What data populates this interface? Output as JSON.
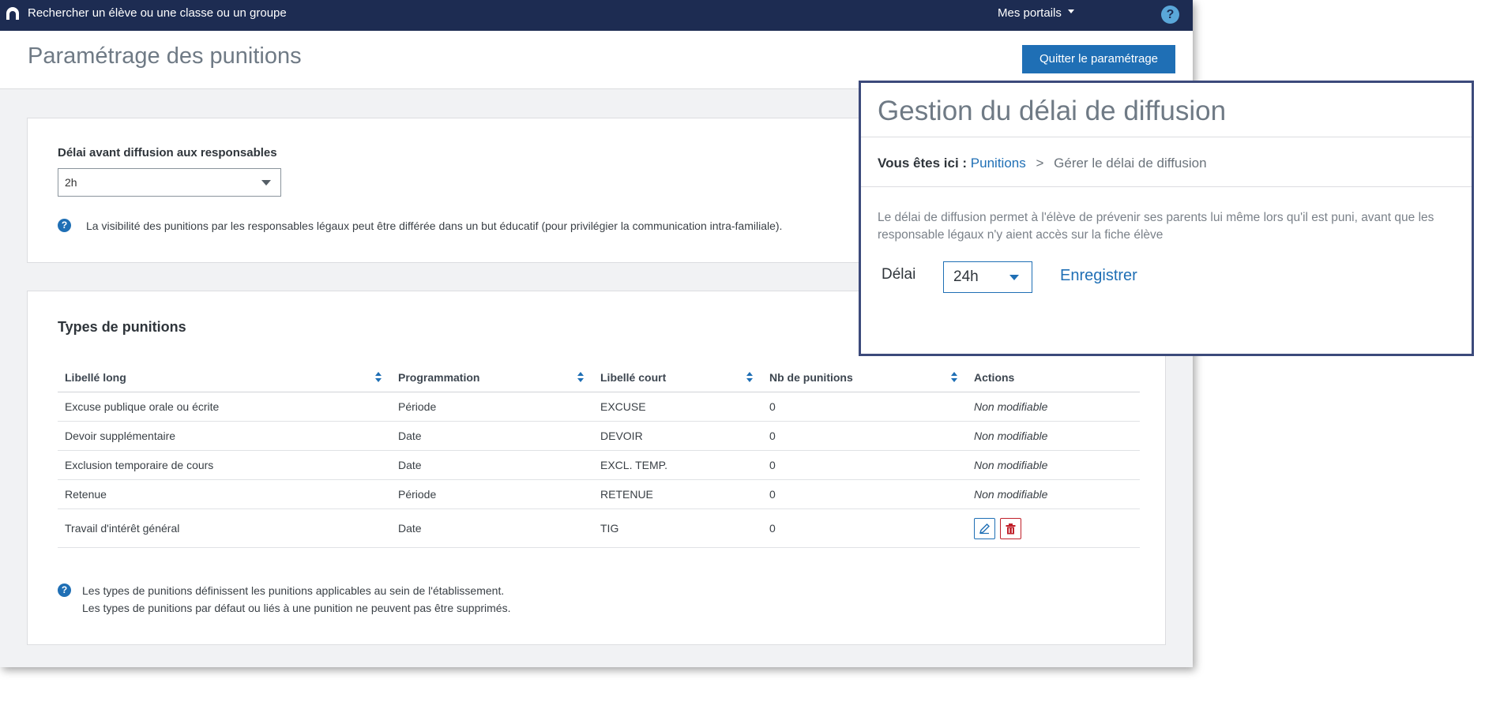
{
  "topbar": {
    "search_placeholder": "Rechercher un élève ou une classe ou un groupe",
    "portals_label": "Mes portails",
    "help_glyph": "?"
  },
  "header": {
    "title": "Paramétrage des punitions",
    "quit_label": "Quitter le paramétrage"
  },
  "delay_section": {
    "label": "Délai avant diffusion aux responsables",
    "selected": "2h",
    "info": "La visibilité des punitions par les responsables légaux peut être différée dans un but éducatif (pour privilégier la communication intra-familiale)."
  },
  "types_section": {
    "title": "Types de punitions",
    "columns": [
      "Libellé long",
      "Programmation",
      "Libellé court",
      "Nb de punitions",
      "Actions"
    ],
    "rows": [
      {
        "long": "Excuse publique orale ou écrite",
        "prog": "Période",
        "short": "EXCUSE",
        "count": "0",
        "action": "Non modifiable"
      },
      {
        "long": "Devoir supplémentaire",
        "prog": "Date",
        "short": "DEVOIR",
        "count": "0",
        "action": "Non modifiable"
      },
      {
        "long": "Exclusion temporaire de cours",
        "prog": "Date",
        "short": "EXCL. TEMP.",
        "count": "0",
        "action": "Non modifiable"
      },
      {
        "long": "Retenue",
        "prog": "Période",
        "short": "RETENUE",
        "count": "0",
        "action": "Non modifiable"
      },
      {
        "long": "Travail d'intérêt général",
        "prog": "Date",
        "short": "TIG",
        "count": "0",
        "action": ""
      }
    ],
    "info_line1": "Les types de punitions définissent les punitions applicables au sein de l'établissement.",
    "info_line2": "Les types de punitions par défaut ou liés à une punition ne peuvent pas être supprimés."
  },
  "overlay": {
    "title": "Gestion du délai de diffusion",
    "breadcrumb_lead": "Vous êtes ici :",
    "breadcrumb_link": "Punitions",
    "breadcrumb_sep": ">",
    "breadcrumb_current": "Gérer le délai de diffusion",
    "description": "Le délai de diffusion permet à l'élève de prévenir ses parents lui même lors qu'il est puni, avant que les responsable légaux n'y aient accès sur la fiche élève",
    "delay_label": "Délai",
    "delay_value": "24h",
    "save_label": "Enregistrer"
  },
  "colors": {
    "topbar": "#1d2c52",
    "primary": "#1f6fb5",
    "danger": "#c0202a",
    "overlay_border": "#3c4a7b"
  }
}
